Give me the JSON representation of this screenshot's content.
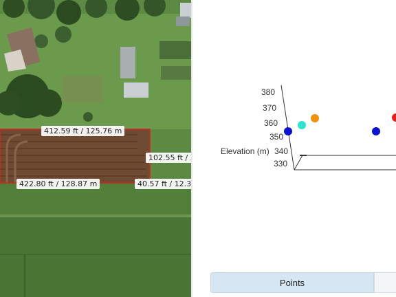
{
  "map": {
    "measurements": {
      "top": "412.59 ft / 125.76 m",
      "right": "102.55 ft / 3",
      "bottom": "422.80 ft / 128.87 m",
      "bottom_right": "40.57 ft / 12.37"
    },
    "colors": {
      "field": "#6e4a32",
      "selection": "#e02020"
    }
  },
  "plot": {
    "axis_label": "Elevation (m)",
    "tick_labels": [
      "380",
      "370",
      "360",
      "350",
      "340",
      "330"
    ]
  },
  "tabs": {
    "points_label": "Points"
  },
  "chart_data": {
    "type": "scatter",
    "z_label": "Elevation (m)",
    "z_ticks": [
      330,
      340,
      350,
      360,
      370,
      380
    ],
    "points": [
      {
        "color": "#0a12d6"
      },
      {
        "color": "#2ee6d0"
      },
      {
        "color": "#f0900c"
      },
      {
        "color": "#0a12d6"
      },
      {
        "color": "#e8201c"
      }
    ]
  }
}
